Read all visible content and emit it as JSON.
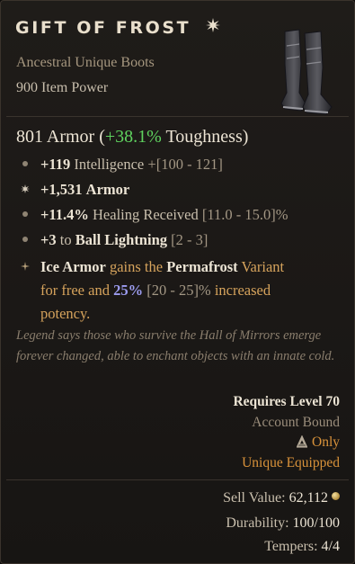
{
  "item": {
    "name": "GIFT OF FROST",
    "type": "Ancestral Unique Boots",
    "item_power": "900 Item Power",
    "icon": "boots-icon"
  },
  "armor": {
    "value": "801 Armor",
    "open": "(",
    "bonus": "+38.1%",
    "stat": "Toughness",
    "close": ")"
  },
  "affixes": [
    {
      "icon": "dot",
      "value": "+119",
      "text": "Intelligence",
      "range": "+[100 - 121]"
    },
    {
      "icon": "implicit-star",
      "value": "+1,531",
      "text": "Armor",
      "range": ""
    },
    {
      "icon": "dot",
      "value": "+11.4%",
      "text": "Healing Received",
      "range": "[11.0 - 15.0]%"
    },
    {
      "icon": "dot",
      "value": "+3",
      "text": "to",
      "skill": "Ball Lightning",
      "range": "[2 - 3]"
    }
  ],
  "aspect": {
    "icon": "unique-power-icon",
    "skill": "Ice Armor",
    "t1": "gains the",
    "variant": "Permafrost",
    "t2": "Variant",
    "t3": "for free and",
    "percent": "25%",
    "range": "[20 - 25]%",
    "t4": "increased",
    "t5": "potency."
  },
  "flavor": "Legend says those who survive the Hall of Mirrors emerge forever changed, able to enchant objects with an innate cold.",
  "requirements": {
    "level": "Requires Level 70",
    "bound": "Account Bound",
    "class_only": "Only",
    "class_icon": "sorcerer-class-icon",
    "equipped": "Unique Equipped"
  },
  "stats": {
    "sell_label": "Sell Value:",
    "sell_value": "62,112",
    "durability_label": "Durability:",
    "durability_value": "100/100",
    "tempers_label": "Tempers:",
    "tempers_value": "4/4"
  },
  "colors": {
    "unique_title": "#e9dfcc",
    "toughness_bonus": "#5fd35f",
    "orange_requirement": "#d9923a",
    "aspect_percent": "#9c9cf0"
  }
}
